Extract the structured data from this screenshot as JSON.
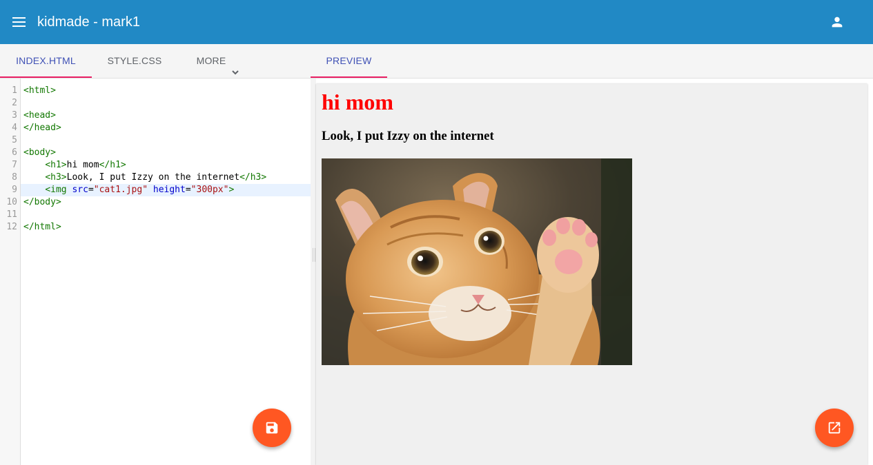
{
  "appbar": {
    "menu_icon": "menu-icon",
    "title": "kidmade - mark1",
    "account_icon": "person-icon",
    "color": "#2189c5"
  },
  "tabs": {
    "items": [
      {
        "label": "INDEX.HTML",
        "active": true
      },
      {
        "label": "STYLE.CSS",
        "active": false
      },
      {
        "label": "MORE",
        "active": false,
        "icon": "chevron-down-icon"
      }
    ],
    "preview": {
      "label": "PREVIEW",
      "active": true
    }
  },
  "editor": {
    "active_line": 9,
    "line_numbers": [
      "1",
      "2",
      "3",
      "4",
      "5",
      "6",
      "7",
      "8",
      "9",
      "10",
      "11",
      "12"
    ],
    "lines": [
      "<html>",
      "",
      "<head>",
      "</head>",
      "",
      "<body>",
      "    <h1>hi mom</h1>",
      "    <h3>Look, I put Izzy on the internet</h3>",
      "    <img src=\"cat1.jpg\" height=\"300px\">",
      "</body>",
      "",
      "</html>"
    ]
  },
  "preview": {
    "h1": "hi mom",
    "h3": "Look, I put Izzy on the internet",
    "image": "kitten-photo"
  },
  "fabs": {
    "save_icon": "save-icon",
    "open_external_icon": "open-in-new-icon",
    "color": "#ff5722"
  }
}
